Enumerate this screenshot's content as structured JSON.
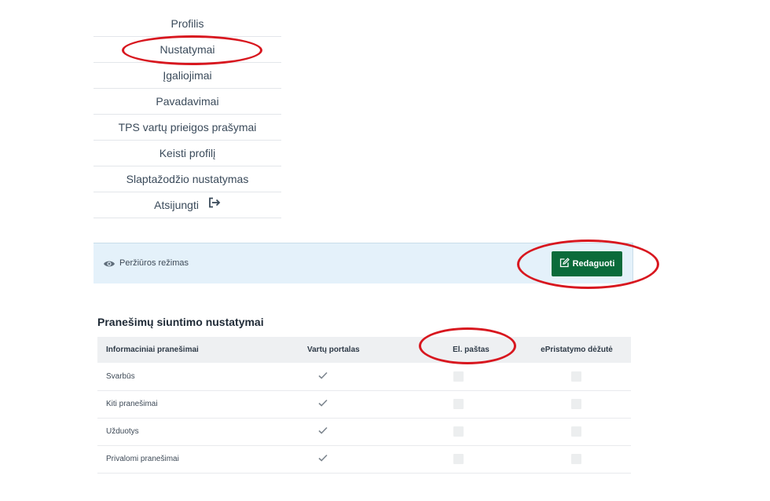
{
  "menu": {
    "items": [
      {
        "label": "Profilis"
      },
      {
        "label": "Nustatymai"
      },
      {
        "label": "Įgaliojimai"
      },
      {
        "label": "Pavadavimai"
      },
      {
        "label": "TPS vartų prieigos prašymai"
      },
      {
        "label": "Keisti profilį"
      },
      {
        "label": "Slaptažodžio nustatymas"
      },
      {
        "label": "Atsijungti"
      }
    ]
  },
  "mode_bar": {
    "label": "Peržiūros režimas",
    "edit_button": "Redaguoti",
    "edit_color": "#0b6b3a"
  },
  "settings": {
    "title": "Pranešimų siuntimo nustatymai",
    "columns": [
      "Informaciniai pranešimai",
      "Vartų portalas",
      "El. paštas",
      "ePristatymo dėžutė"
    ],
    "rows": [
      {
        "label": "Svarbūs",
        "portal": true,
        "email": false,
        "epristatymas": false
      },
      {
        "label": "Kiti pranešimai",
        "portal": true,
        "email": false,
        "epristatymas": false
      },
      {
        "label": "Užduotys",
        "portal": true,
        "email": false,
        "epristatymas": false
      },
      {
        "label": "Privalomi pranešimai",
        "portal": true,
        "email": false,
        "epristatymas": false
      }
    ]
  },
  "annotation_color": "#d8171f"
}
